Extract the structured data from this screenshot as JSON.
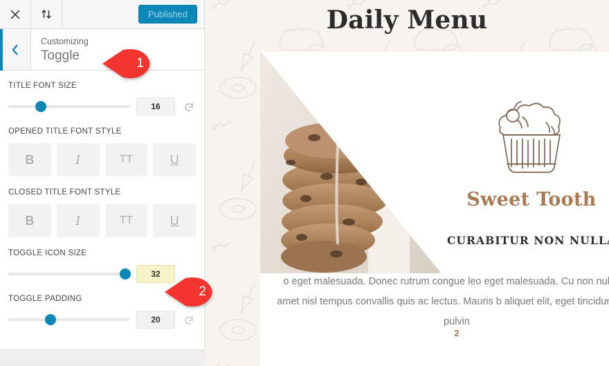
{
  "customizer": {
    "toolbar": {
      "close_icon": "close-icon",
      "devices_icon": "up-down-arrows-icon",
      "publish_label": "Published"
    },
    "header": {
      "back_icon": "chevron-left-icon",
      "kicker": "Customizing",
      "title": "Toggle"
    },
    "controls": [
      {
        "key": "title_font_size",
        "label": "TITLE FONT SIZE",
        "type": "slider",
        "value": "16",
        "slider_percent": 22,
        "highlighted": false,
        "reset_icon": "reset-icon",
        "has_reset": true
      },
      {
        "key": "opened_title_font_style",
        "label": "OPENED TITLE FONT STYLE",
        "type": "style-buttons",
        "buttons": [
          {
            "name": "bold-button",
            "label": "B"
          },
          {
            "name": "italic-button",
            "label": "I"
          },
          {
            "name": "uppercase-button",
            "label": "TT"
          },
          {
            "name": "underline-button",
            "label": "U"
          }
        ]
      },
      {
        "key": "closed_title_font_style",
        "label": "CLOSED TITLE FONT STYLE",
        "type": "style-buttons",
        "buttons": [
          {
            "name": "bold-button",
            "label": "B"
          },
          {
            "name": "italic-button",
            "label": "I"
          },
          {
            "name": "uppercase-button",
            "label": "TT"
          },
          {
            "name": "underline-button",
            "label": "U"
          }
        ]
      },
      {
        "key": "toggle_icon_size",
        "label": "TOGGLE ICON SIZE",
        "type": "slider",
        "value": "32",
        "slider_percent": 92,
        "highlighted": true,
        "reset_icon": "reset-icon",
        "has_reset": false
      },
      {
        "key": "toggle_padding",
        "label": "TOGGLE PADDING",
        "type": "slider",
        "value": "20",
        "slider_percent": 30,
        "highlighted": false,
        "reset_icon": "reset-icon",
        "has_reset": true
      }
    ],
    "callouts": [
      {
        "number": "1"
      },
      {
        "number": "2"
      }
    ],
    "colors": {
      "accent": "#0d87b8",
      "callout": "#f4342f",
      "highlight": "#f6f3c8"
    }
  },
  "preview": {
    "site_title": "Daily Menu",
    "card": {
      "photo_alt": "stack-of-cookies-photo",
      "cupcake_icon": "cupcake-icon",
      "heading": "Sweet Tooth",
      "subheading": "CURABITUR NON NULLA",
      "body": "o eget malesuada. Donec rutrum congue leo eget malesuada. Cu non nulla sit amet nisl tempus convallis quis ac lectus. Mauris b aliquet elit, eget tincidunt nibh pulvin",
      "page_number": "2"
    },
    "colors": {
      "background": "#f7f4ef",
      "heading": "#a97b55",
      "page_number": "#b07a45"
    }
  }
}
